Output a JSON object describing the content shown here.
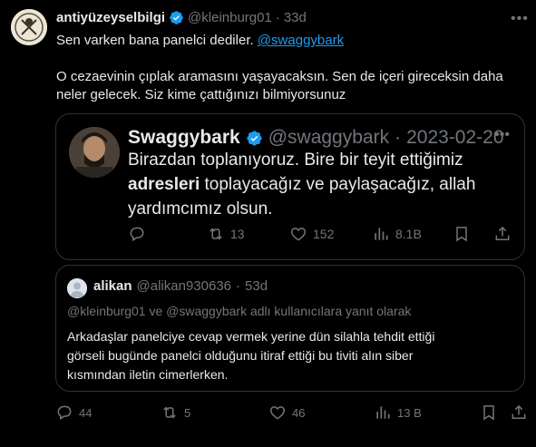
{
  "tweet": {
    "author_name": "antiyüzeyselbilgi",
    "author_handle": "@kleinburg01",
    "separator": "·",
    "time": "33d",
    "line1_text": "Sen varken bana panelci dediler.",
    "line1_mention": "@swaggybark",
    "line2": "O cezaevinin çıplak aramasını yaşayacaksın. Sen de içeri gireceksin daha",
    "line3": "neler gelecek. Siz kime çattığınızı bilmiyorsunuz",
    "more_icon": "more-dots-icon"
  },
  "quoted_tweet": {
    "author_name": "Swaggybark",
    "author_handle": "@swaggybark",
    "separator": "·",
    "date": "2023-02-20",
    "text_part1": "Birazdan toplanıyoruz. Bire bir teyit ettiğimiz",
    "text_bold": "adresleri",
    "text_part2": " toplayacağız ve paylaşacağız, allah",
    "text_part3": "yardımcımız olsun.",
    "replies": "",
    "retweets": "13",
    "likes": "152",
    "views": "8.1B"
  },
  "reply_tweet": {
    "author_name": "alikan",
    "author_handle": "@alikan930636",
    "separator": "·",
    "time": "53d",
    "reply_context": "@kleinburg01 ve @swaggybark adlı kullanıcılara yanıt olarak",
    "text_line1": "Arkadaşlar panelciye cevap vermek yerine dün silahla tehdit ettiği",
    "text_line2": "görseli bugünde panelci olduğunu itiraf ettiği bu tiviti alın siber",
    "text_line3": "kısmından iletin cimerlerken."
  },
  "tweet_actions": {
    "replies": "44",
    "retweets": "5",
    "likes": "46",
    "views": "13 B"
  },
  "colors": {
    "background": "#000000",
    "text": "#e7e9ea",
    "muted": "#71767b",
    "accent": "#1d9bf0",
    "border": "#2f3336"
  }
}
